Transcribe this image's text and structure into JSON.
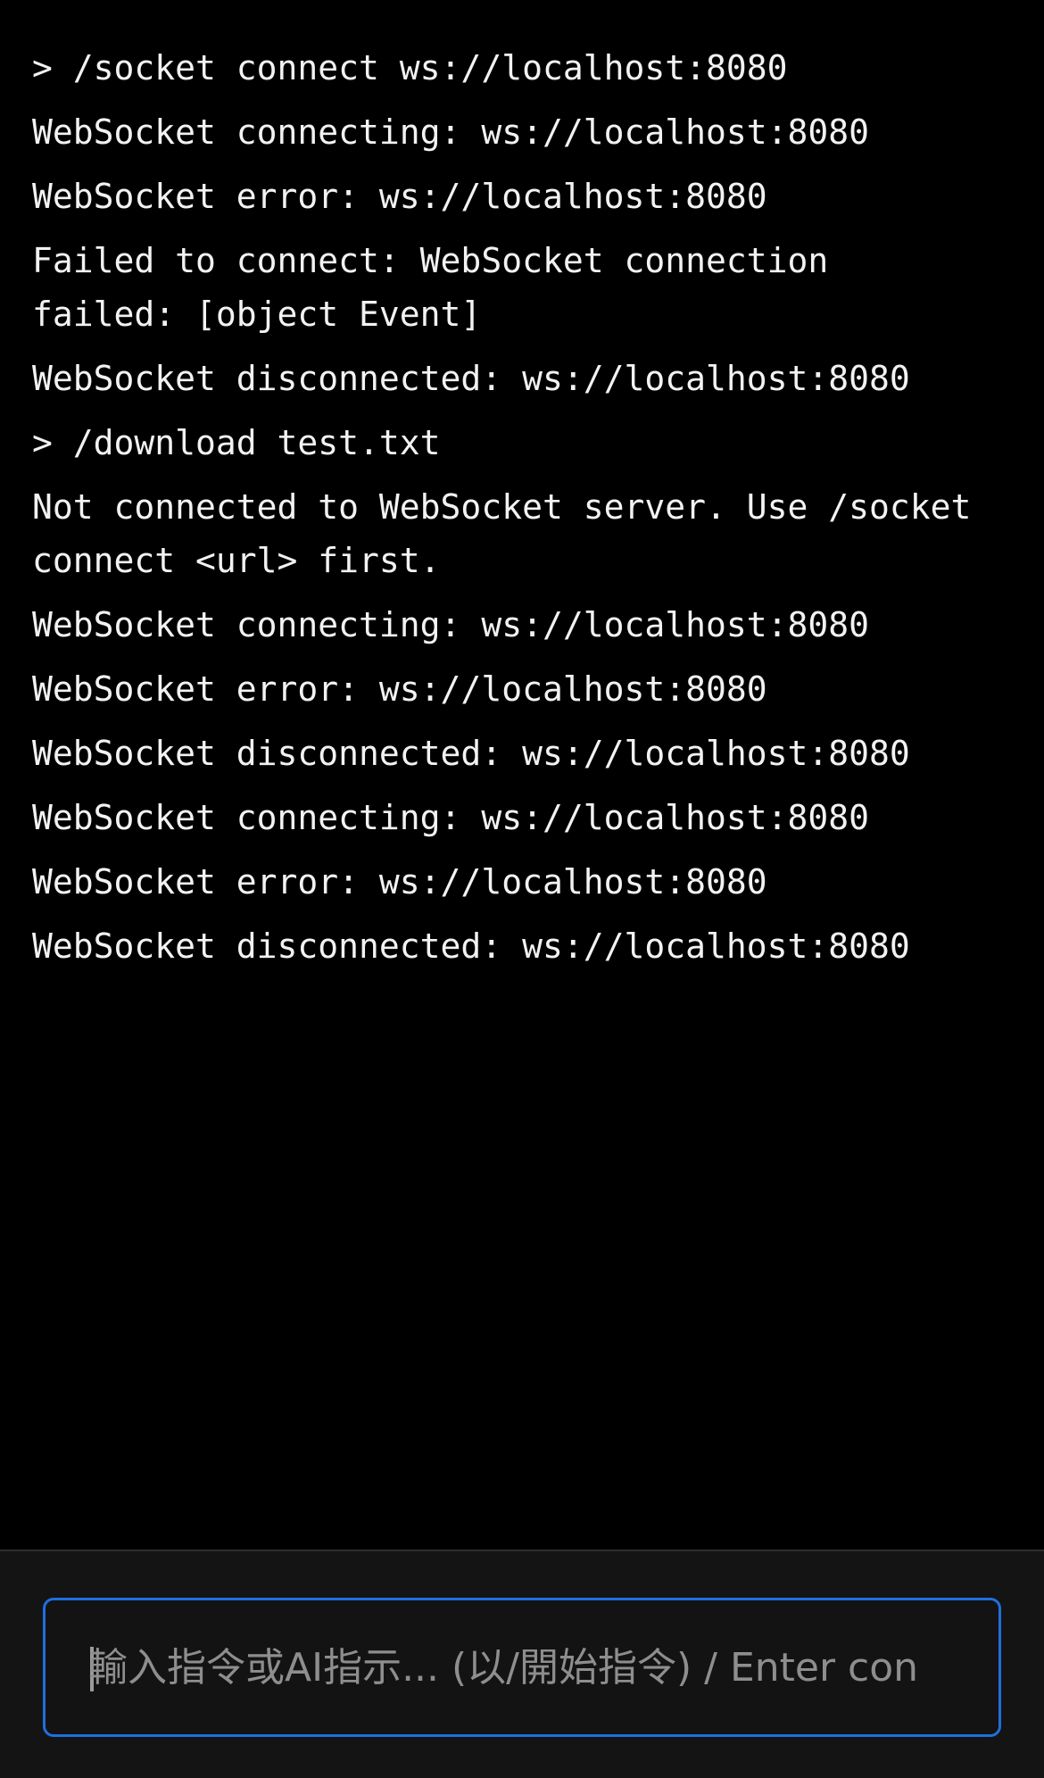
{
  "terminal": {
    "lines": [
      "> /socket connect ws://localhost:8080",
      "WebSocket connecting: ws://localhost:8080",
      "WebSocket error: ws://localhost:8080",
      "Failed to connect: WebSocket connection\nfailed: [object Event]",
      "WebSocket disconnected: ws://localhost:8080",
      "> /download test.txt",
      "Not connected to WebSocket server. Use /socket\nconnect <url> first.",
      "WebSocket connecting: ws://localhost:8080",
      "WebSocket error: ws://localhost:8080",
      "WebSocket disconnected: ws://localhost:8080",
      "WebSocket connecting: ws://localhost:8080",
      "WebSocket error: ws://localhost:8080",
      "WebSocket disconnected: ws://localhost:8080"
    ]
  },
  "input": {
    "placeholder": "輸入指令或AI指示... (以/開始指令) / Enter con",
    "value": ""
  },
  "colors": {
    "background": "#000000",
    "text": "#f2f2f2",
    "input_border": "#1f6fe0",
    "input_bar": "#141414"
  }
}
